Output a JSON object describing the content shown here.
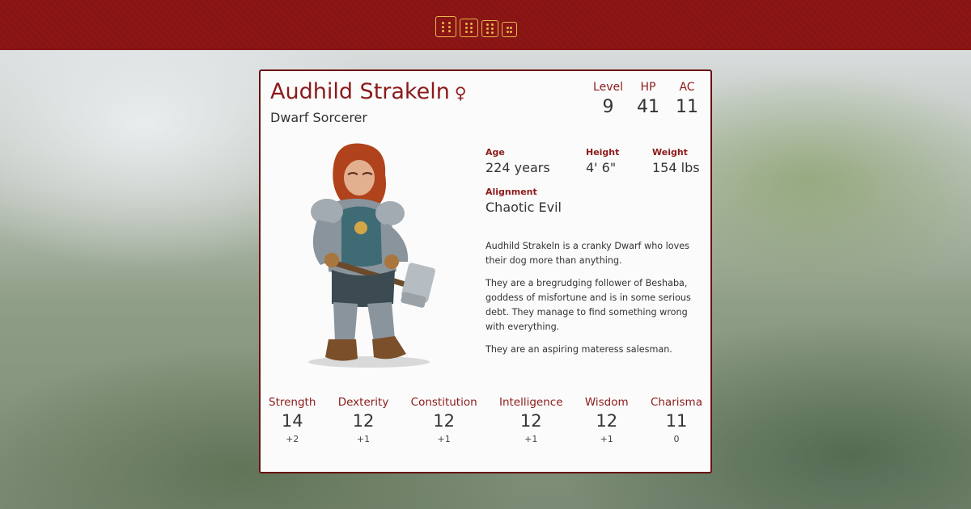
{
  "header": {
    "icons": [
      "dice-icon",
      "dice-icon",
      "dice-icon",
      "dice-icon"
    ],
    "color": "#8c1515",
    "accent": "#e6b94a"
  },
  "character": {
    "name": "Audhild Strakeln",
    "gender_symbol": "♀",
    "subtitle": "Dwarf Sorcerer",
    "core_stats": [
      {
        "label": "Level",
        "value": "9"
      },
      {
        "label": "HP",
        "value": "41"
      },
      {
        "label": "AC",
        "value": "11"
      }
    ],
    "details": {
      "age": {
        "label": "Age",
        "value": "224 years"
      },
      "height": {
        "label": "Height",
        "value": "4' 6\""
      },
      "weight": {
        "label": "Weight",
        "value": "154 lbs"
      },
      "alignment": {
        "label": "Alignment",
        "value": "Chaotic Evil"
      }
    },
    "bio": [
      "Audhild Strakeln is a cranky Dwarf who loves their dog more than anything.",
      "They are a bregrudging follower of Beshaba, goddess of misfortune and is in some serious debt. They manage to find something wrong with everything.",
      "They are an aspiring materess salesman."
    ],
    "abilities": [
      {
        "name": "Strength",
        "score": "14",
        "mod": "+2"
      },
      {
        "name": "Dexterity",
        "score": "12",
        "mod": "+1"
      },
      {
        "name": "Constitution",
        "score": "12",
        "mod": "+1"
      },
      {
        "name": "Intelligence",
        "score": "12",
        "mod": "+1"
      },
      {
        "name": "Wisdom",
        "score": "12",
        "mod": "+1"
      },
      {
        "name": "Charisma",
        "score": "11",
        "mod": "0"
      }
    ]
  },
  "colors": {
    "accent": "#8c1a1a",
    "card_border": "#6a1212",
    "text": "#333333"
  }
}
